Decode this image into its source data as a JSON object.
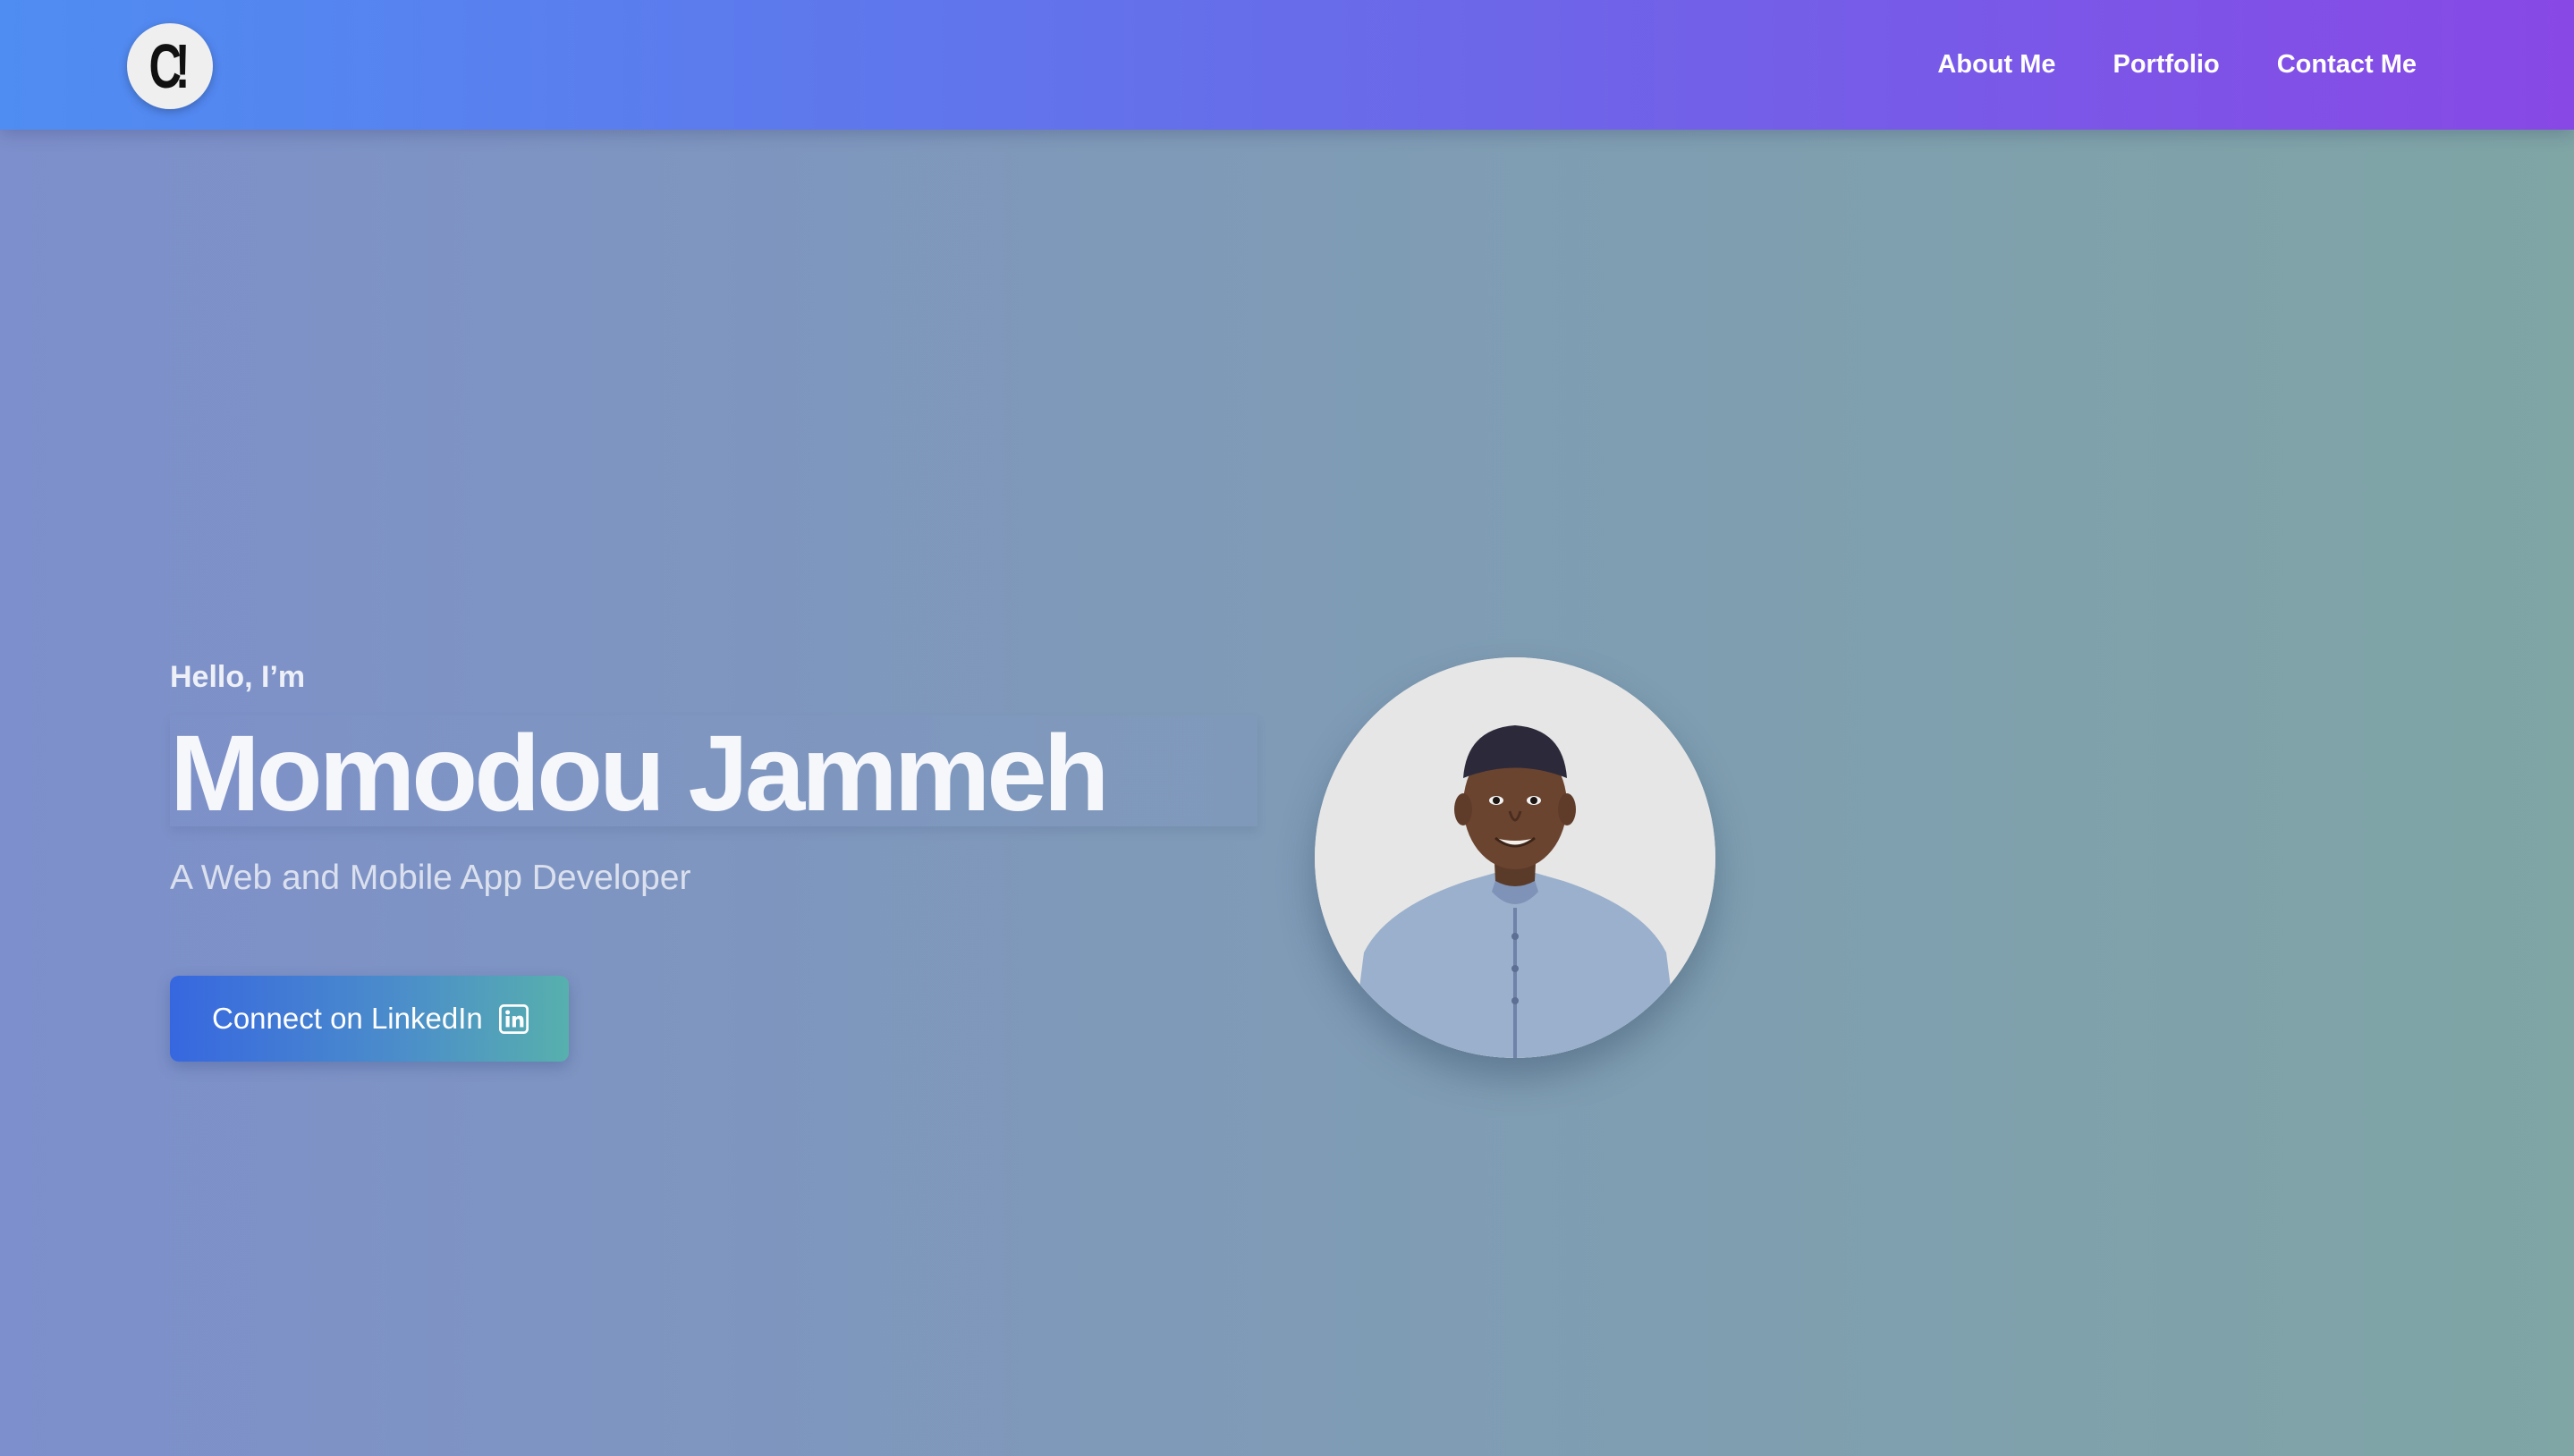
{
  "navbar": {
    "logo_text": "C!",
    "links": [
      {
        "label": "About Me"
      },
      {
        "label": "Portfolio"
      },
      {
        "label": "Contact Me"
      }
    ]
  },
  "hero": {
    "greeting": "Hello, I’m",
    "name": "Momodou Jammeh",
    "subtitle": "A Web and Mobile App Developer",
    "cta_label": "Connect on LinkedIn",
    "cta_icon": "linkedin-icon"
  },
  "avatar": {
    "icon": "profile-photo"
  },
  "colors": {
    "navbar_start": "#4f8df2",
    "navbar_end": "#8848e6",
    "background_start": "#7d8fcc",
    "background_end": "#7fa5a5",
    "button_start": "#3767e0",
    "button_end": "#57b0ad"
  }
}
